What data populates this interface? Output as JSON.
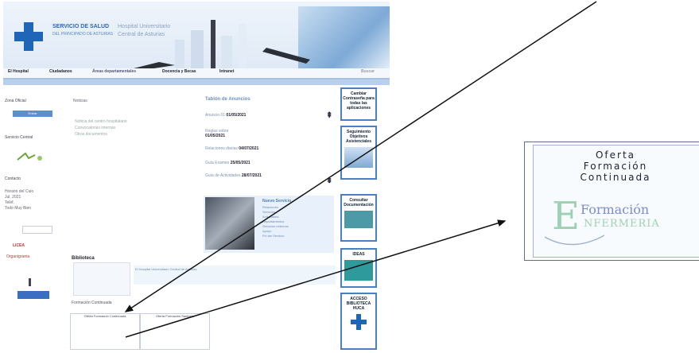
{
  "header": {
    "brand_line1": "SERVICIO DE SALUD",
    "brand_line2": "DEL PRINCIPADO DE ASTURIAS",
    "hospital_line1": "Hospital Universitario",
    "hospital_line2": "Central de Asturias"
  },
  "nav": {
    "items": [
      "El Hospital",
      "Ciudadanos",
      "Áreas departamentales",
      "Docencia y Becas",
      "Intranet"
    ],
    "right": "Buscar"
  },
  "left": {
    "zona_label": "Zona Oficial",
    "btn1": "Entrar",
    "bienvenida": "Servicio Central",
    "valores": "Contacto",
    "info1": "Horario del Cuio",
    "info2": "Jul. 2021",
    "info3": "Teléf.",
    "info4": "Todo Muy Bien",
    "logo_text": "LICEA",
    "logo_sub": "Organigrama"
  },
  "middle": {
    "heading": "Noticias",
    "items": [
      "Noticia del centro hospitalario",
      "Convocatorias internas",
      "Otros documentos"
    ]
  },
  "announcements": {
    "title": "Tablón de Anuncios",
    "rows": [
      {
        "label": "Anuncio 01",
        "date": "01/05/2021"
      },
      {
        "label": "Reglas sobre ",
        "date": "01/05/2021"
      },
      {
        "label": "Relaciones diarias",
        "date": "04/07/2021"
      },
      {
        "label": "Guía Exames",
        "date": "25/05/2021"
      },
      {
        "label": "Guía de Actividades",
        "date": "28/07/2021"
      }
    ]
  },
  "feature": {
    "title": "Nuevo Servicio",
    "lines": [
      "Relaciones",
      "Servicios",
      "Actividades",
      "Departamentos",
      "Servicios externos",
      "Apoyo",
      "Fin del Servicio"
    ]
  },
  "right_boxes": [
    {
      "label": "Cambiar Contraseña para todas las aplicaciones"
    },
    {
      "label": "Seguimiento Objetivos Asistenciales"
    },
    {
      "label": "Consultar Documentación"
    },
    {
      "label": "IDEAS"
    },
    {
      "label": "ACCESO BIBLIOTECA HUCA"
    }
  ],
  "bottom": {
    "section1": "Biblioteca",
    "line1": "El Hospital Universitario Central de Asturias",
    "section2": "Formación Continuada",
    "thumb1": "Oferta Formación Continuada",
    "thumb2": "Oferta Formación Sanitaria"
  },
  "zoom": {
    "line1": "Oferta",
    "line2": "Formación",
    "line3": "Continuada",
    "logo_big": "E",
    "logo_word1": "Formación",
    "logo_word2": "NFERMERIA"
  }
}
